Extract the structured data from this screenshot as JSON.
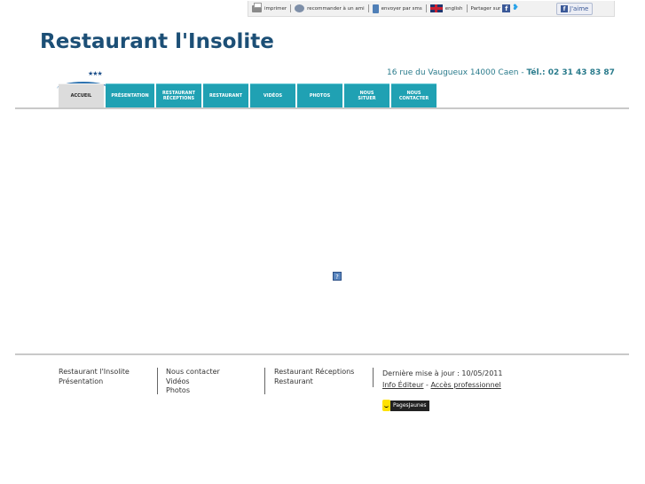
{
  "toolbar": {
    "print": "imprimer",
    "recommend": "recommander à un ami",
    "sms": "envoyer par sms",
    "language": "english",
    "share": "Partager sur",
    "like": "J'aime"
  },
  "header": {
    "title": "Restaurant l'Insolite",
    "stars": "★★★",
    "address": "16 rue du Vaugueux 14000 Caen",
    "tel_label": "Tél.: 02 31 43 83 87"
  },
  "nav": {
    "tabs": [
      {
        "label": "Accueil"
      },
      {
        "label": "Présentation"
      },
      {
        "label": "Restaurant Réceptions"
      },
      {
        "label": "Restaurant"
      },
      {
        "label": "Vidéos"
      },
      {
        "label": "Photos"
      },
      {
        "label": "Nous situer"
      },
      {
        "label": "Nous contacter"
      }
    ]
  },
  "content": {
    "broken_image": "?"
  },
  "footer": {
    "col1": [
      "Restaurant l'Insolite",
      "Présentation"
    ],
    "col2": [
      "Nous contacter",
      "Vidéos",
      "Photos"
    ],
    "col3": [
      "Restaurant Réceptions",
      "Restaurant"
    ],
    "last_update": "Dernière mise à jour : 10/05/2011",
    "info_editeur": "Info Éditeur",
    "dash": "-",
    "pro_access": "Accès professionnel",
    "pagesjaunes": "PagesJaunes"
  },
  "colors": {
    "title": "#1c4f76",
    "tab": "#20a1b3",
    "tab_active": "#dcdcdc",
    "address": "#2a7b8c"
  }
}
